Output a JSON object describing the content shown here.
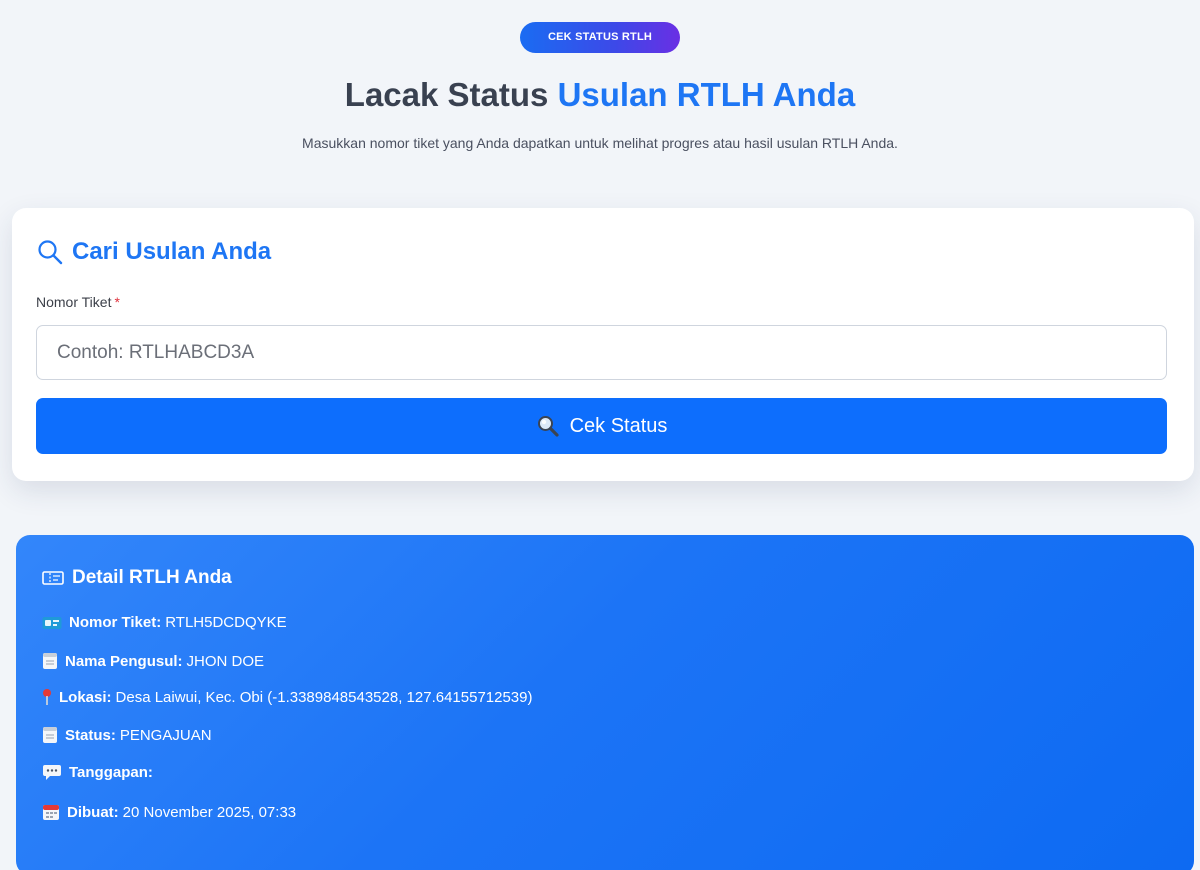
{
  "header": {
    "badge": "CEK STATUS RTLH",
    "title_plain": "Lacak Status ",
    "title_accent": "Usulan RTLH Anda",
    "subtitle": "Masukkan nomor tiket yang Anda dapatkan untuk melihat progres atau hasil usulan RTLH Anda."
  },
  "search": {
    "title": "Cari Usulan Anda",
    "field_label": "Nomor Tiket",
    "required_mark": "*",
    "placeholder": "Contoh: RTLHABCD3A",
    "value": "",
    "button_label": "Cek Status"
  },
  "detail": {
    "title": "Detail RTLH Anda",
    "rows": [
      {
        "icon": "ticket-icon",
        "label": "Nomor Tiket:",
        "value": "RTLH5DCDQYKE"
      },
      {
        "icon": "document-icon",
        "label": "Nama Pengusul:",
        "value": "JHON DOE"
      },
      {
        "icon": "pin-icon",
        "label": "Lokasi:",
        "value": "Desa Laiwui, Kec. Obi (-1.3389848543528, 127.64155712539)"
      },
      {
        "icon": "document-icon",
        "label": "Status:",
        "value": "PENGAJUAN"
      },
      {
        "icon": "speech-bubble-icon",
        "label": "Tanggapan:",
        "value": ""
      },
      {
        "icon": "calendar-icon",
        "label": "Dibuat:",
        "value": "20 November 2025, 07:33"
      }
    ]
  },
  "colors": {
    "accent": "#1e76f4",
    "button": "#0d6efd",
    "panel": "#1c74f6",
    "required": "#e0313c"
  }
}
